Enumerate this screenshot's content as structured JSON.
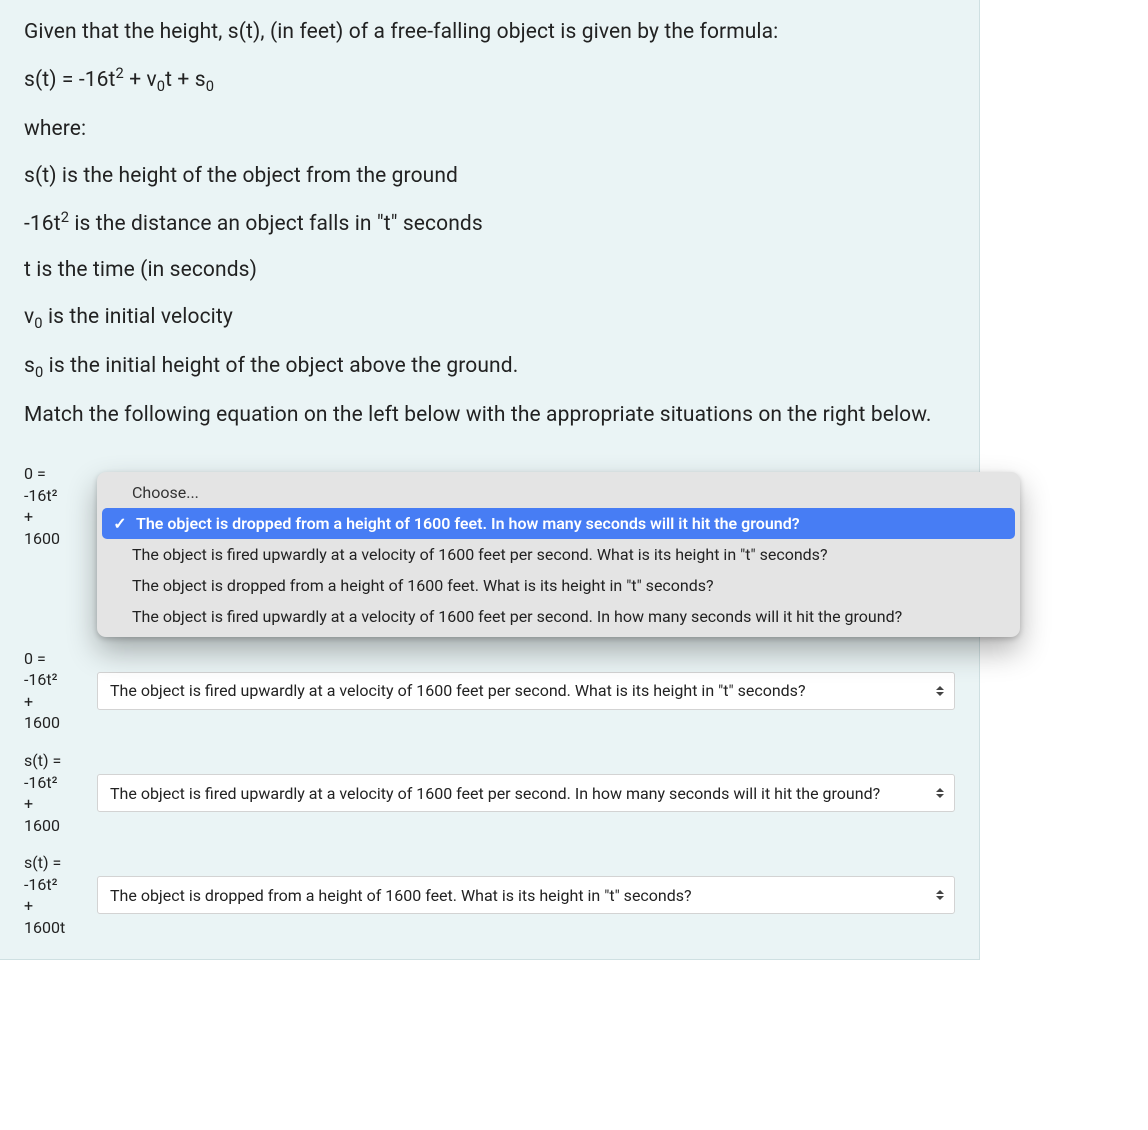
{
  "question": {
    "intro": "Given that the height, s(t), (in feet) of a free-falling object is given by the formula:",
    "formula_html": "s(t) = -16t<sup>2</sup> + v<sub>0</sub>t + s<sub>0</sub>",
    "where_label": "where:",
    "def_s": "s(t) is the height of the object from the ground",
    "def_16t2_html": "-16t<sup>2</sup> is the distance an object falls in \"t\" seconds",
    "def_t": "t is the time (in seconds)",
    "def_v0_html": "v<sub>0</sub> is the initial velocity",
    "def_s0_html": "s<sub>0</sub> is the initial height of the object above the ground.",
    "instruction": "Match the following equation on the left below with the appropriate situations on the right below."
  },
  "dropdown": {
    "placeholder": "Choose...",
    "options": {
      "opt1": "The object is dropped from a height of 1600 feet. In how many seconds will it hit the ground?",
      "opt2": "The object is fired upwardly at a velocity of 1600 feet per second. What is its height in \"t\" seconds?",
      "opt3": "The object is dropped from a height of 1600 feet. What is its height in \"t\" seconds?",
      "opt4": "The object is fired upwardly at a velocity of 1600 feet per second. In how many seconds will it hit the ground?"
    }
  },
  "rows": [
    {
      "equation_lines": [
        "0 =",
        "-16t²",
        "+",
        "1600"
      ],
      "selected": "The object is dropped from a height of 1600 feet. In how many seconds will it hit the ground?",
      "open": true
    },
    {
      "equation_lines": [
        "0 =",
        "-16t²",
        "+",
        "1600"
      ],
      "selected": "The object is fired upwardly at a velocity of 1600 feet per second. What is its height in \"t\" seconds?",
      "open": false
    },
    {
      "equation_lines": [
        "s(t) =",
        "-16t²",
        "+",
        "1600"
      ],
      "selected": "The object is fired upwardly at a velocity of 1600 feet per second. In how many seconds will it hit the ground?",
      "open": false
    },
    {
      "equation_lines": [
        "s(t) =",
        "-16t²",
        "+",
        "1600t"
      ],
      "selected": "The object is dropped from a height of 1600 feet. What is its height in \"t\" seconds?",
      "open": false
    }
  ]
}
